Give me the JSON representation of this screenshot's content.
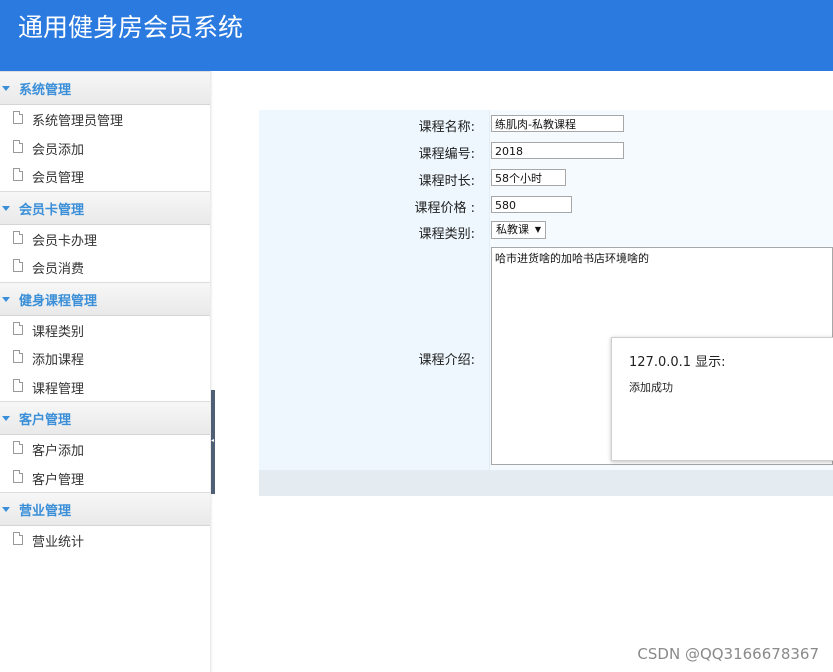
{
  "header": {
    "title": "通用健身房会员系统",
    "bg_color": "#2b7ae0"
  },
  "sidebar": {
    "groups": [
      {
        "label": "系统管理",
        "items": [
          "系统管理员管理",
          "会员添加",
          "会员管理"
        ]
      },
      {
        "label": "会员卡管理",
        "items": [
          "会员卡办理",
          "会员消费"
        ]
      },
      {
        "label": "健身课程管理",
        "items": [
          "课程类别",
          "添加课程",
          "课程管理"
        ]
      },
      {
        "label": "客户管理",
        "items": [
          "客户添加",
          "客户管理"
        ]
      },
      {
        "label": "营业管理",
        "items": [
          "营业统计"
        ]
      }
    ]
  },
  "form": {
    "name_label": "课程名称:",
    "name_value": "练肌肉-私教课程",
    "code_label": "课程编号:",
    "code_value": "2018",
    "duration_label": "课程时长:",
    "duration_value": "58个小时",
    "price_label": "课程价格 :",
    "price_value": "580",
    "category_label": "课程类别:",
    "category_value": "私教课",
    "intro_label": "课程介绍:",
    "intro_value": "哈市进货啥的加哈书店环境啥的"
  },
  "dialog": {
    "title": "127.0.0.1 显示:",
    "message": "添加成功"
  },
  "watermark": "CSDN @QQ3166678367"
}
